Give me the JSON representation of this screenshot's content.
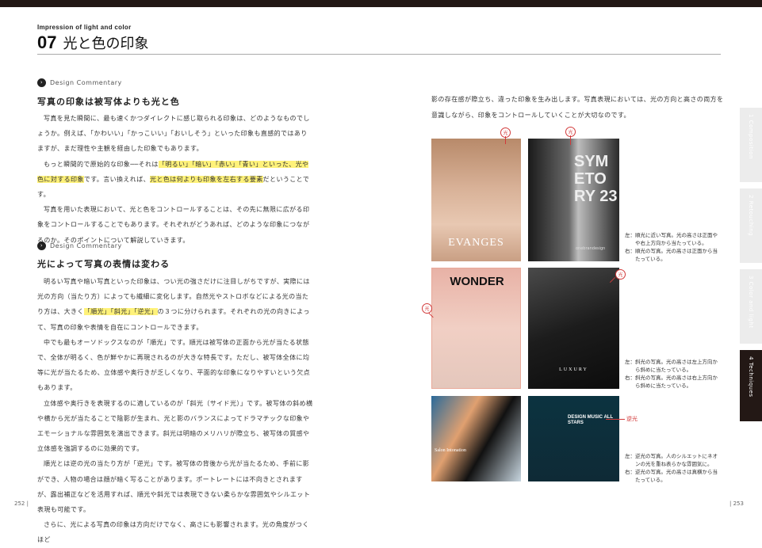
{
  "header": {
    "eyebrow": "Impression of light and color",
    "number": "07",
    "title": "光と色の印象"
  },
  "section1": {
    "label": "Design Commentary",
    "heading": "写真の印象は被写体よりも光と色",
    "p1": "写真を見た瞬間に、最も速くかつダイレクトに感じ取られる印象は、どのようなものでしょうか。例えば、「かわいい」「かっこいい」「おいしそう」といった印象も直感的ではありますが、まだ理性や主観を経由した印象でもあります。",
    "p2a": "もっと瞬間的で原始的な印象──それは",
    "p2b": "「明るい」「暗い」「赤い」「青い」といった、光や色に対する印象",
    "p2c": "です。言い換えれば、",
    "p2d": "光と色は何よりも印象を左右する要素",
    "p2e": "だということです。",
    "p3": "写真を用いた表現において、光と色をコントロールすることは、その先に無限に広がる印象をコントロールすることでもあります。それぞれがどうあれば、どのような印象につながるのか。そのポイントについて解説していきます。"
  },
  "section2": {
    "label": "Design Commentary",
    "heading": "光によって写真の表情は変わる",
    "p1a": "明るい写真や暗い写真といった印象は、つい光の強さだけに注目しがちですが、実際には光の方向（当たり方）によっても繊細に変化します。自然光やストロボなどによる光の当たり方は、大きく",
    "p1b": "「順光」「斜光」「逆光」",
    "p1c": "の３つに分けられます。それぞれの光の向きによって、写真の印象や表情を自在にコントロールできます。",
    "p2": "中でも最もオーソドックスなのが「順光」です。順光は被写体の正面から光が当たる状態で、全体が明るく、色が鮮やかに再現されるのが大きな特長です。ただし、被写体全体に均等に光が当たるため、立体感や奥行きが乏しくなり、平面的な印象になりやすいという欠点もあります。",
    "p3": "立体感や奥行きを表現するのに適しているのが「斜光（サイド光）」です。被写体の斜め横や横から光が当たることで陰影が生まれ、光と影のバランスによってドラマチックな印象やエモーショナルな雰囲気を演出できます。斜光は明暗のメリハリが際立ち、被写体の質感や立体感を強調するのに効果的です。",
    "p4": "順光とは逆の光の当たり方が「逆光」です。被写体の背後から光が当たるため、手前に影ができ、人物の場合は顔が暗く写ることがあります。ポートレートには不向きとされますが、露出補正などを活用すれば、順光や斜光では表現できない柔らかな雰囲気やシルエット表現も可能です。",
    "p5": "さらに、光による写真の印象は方向だけでなく、高さにも影響されます。光の角度がつくほど"
  },
  "right": {
    "p1": "影の存在感が際立ち、違った印象を生み出します。写真表現においては、光の方向と高さの両方を意識しながら、印象をコントロールしていくことが大切なのです。"
  },
  "photos": {
    "p1_brand": "EVANGES",
    "p2_brand": "SYM ETO RY 23",
    "p2_sub": "onebrandesign",
    "p3_brand": "WONDER",
    "p4_brand": "LUXURY",
    "p5_brand": "Salon Intonation",
    "p6_brand": "DESIGN MUSIC ALL STARS"
  },
  "annotations": {
    "light": "光",
    "backlight": "逆光"
  },
  "captions": {
    "row1_left_k": "左：",
    "row1_left": "順光に近い写真。光の高さは正面やや右上方向から当たっている。",
    "row1_right_k": "右：",
    "row1_right": "順光の写真。光の高さは正面から当たっている。",
    "row2_left_k": "左：",
    "row2_left": "斜光の写真。光の高さは左上方向から斜めに当たっている。",
    "row2_right_k": "右：",
    "row2_right": "斜光の写真。光の高さは右上方向から斜めに当たっている。",
    "row3_left_k": "左：",
    "row3_left": "逆光の写真。人のシルエットにネオンの光を重ね表らかな雰囲気に。",
    "row3_right_k": "右：",
    "row3_right": "逆光の写真。光の高さは真横から当たっている。"
  },
  "tabs": [
    "1 Composition",
    "2 Retouching",
    "3 Color and light",
    "4 Techniques"
  ],
  "pages": {
    "left": "252",
    "right": "253"
  }
}
